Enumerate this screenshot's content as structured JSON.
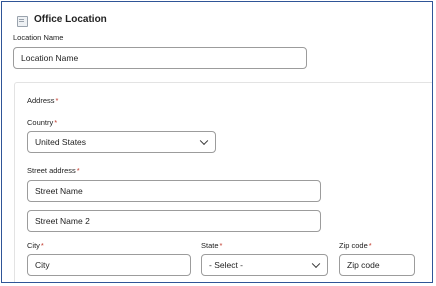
{
  "section": {
    "title": "Office Location",
    "icon": "building-icon"
  },
  "location_name": {
    "label": "Location Name",
    "value": "Location Name"
  },
  "address": {
    "heading": "Address",
    "required_mark": "*",
    "country": {
      "label": "Country",
      "value": "United States"
    },
    "street": {
      "label": "Street address",
      "line1": "Street Name",
      "line2": "Street Name 2"
    },
    "city": {
      "label": "City",
      "value": "City"
    },
    "state": {
      "label": "State",
      "value": "- Select -"
    },
    "zip": {
      "label": "Zip code",
      "value": "Zip code"
    }
  },
  "colors": {
    "frame_border": "#2f5597",
    "required": "#c0392b",
    "field_border": "#9c9c9c"
  }
}
